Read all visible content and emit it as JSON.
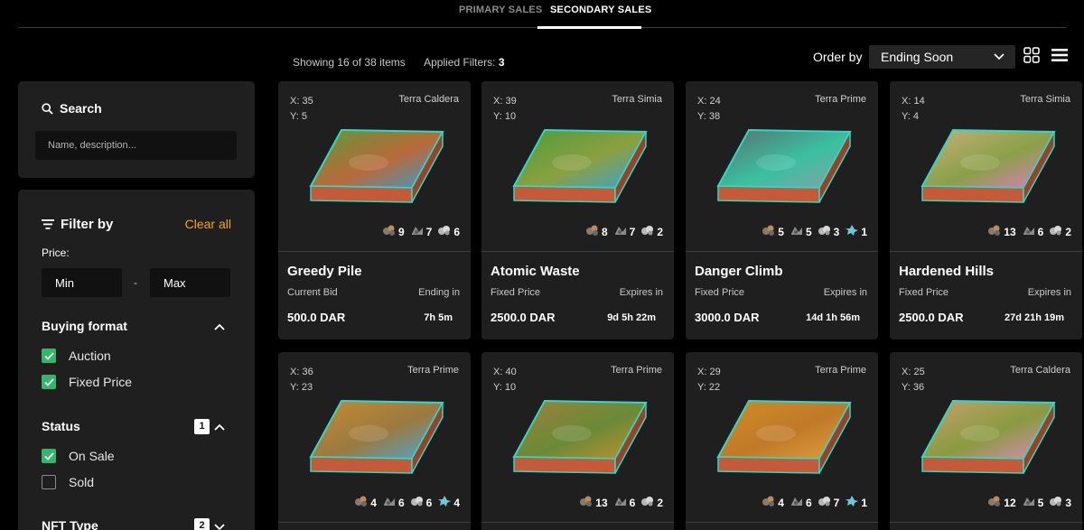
{
  "tabs": {
    "primary": "PRIMARY SALES",
    "secondary": "SECONDARY SALES"
  },
  "results": {
    "showing": "Showing 16 of 38 items",
    "filters_label": "Applied Filters:",
    "filters_count": "3"
  },
  "order": {
    "label": "Order by",
    "selected": "Ending Soon"
  },
  "search": {
    "title": "Search",
    "placeholder": "Name, description..."
  },
  "filter": {
    "title": "Filter by",
    "clear_all": "Clear all",
    "price_label": "Price:",
    "price_min": "Min",
    "price_sep": "-",
    "price_max": "Max",
    "buying_format": {
      "title": "Buying format",
      "options": [
        "Auction",
        "Fixed Price"
      ]
    },
    "status": {
      "title": "Status",
      "count": "1",
      "options": [
        "On Sale",
        "Sold"
      ]
    },
    "nft_type": {
      "title": "NFT Type",
      "count": "2"
    }
  },
  "colors": {
    "accent": "#f4a31c",
    "checkbox": "#33b66b",
    "tile_glow": "#2fd8c8",
    "tile_side": "#c45a38"
  },
  "cards": [
    {
      "x": "X: 35",
      "y": "Y: 5",
      "region": "Terra Caldera",
      "name": "Greedy Pile",
      "price_type": "Current Bid",
      "time_label": "Ending in",
      "price": "500.0 DAR",
      "time": "7h 5m",
      "r": [
        "9",
        "7",
        "6"
      ],
      "top": "#5e9a3a",
      "top2": "#b86a3a",
      "top3": "#3a9ad0"
    },
    {
      "x": "X: 39",
      "y": "Y: 10",
      "region": "Terra Simia",
      "name": "Atomic Waste",
      "price_type": "Fixed Price",
      "time_label": "Expires in",
      "price": "2500.0 DAR",
      "time": "9d 5h 22m",
      "r": [
        "8",
        "7",
        "2"
      ],
      "top": "#4f9a3a",
      "top2": "#8aa040",
      "top3": "#3aa0d8"
    },
    {
      "x": "X: 24",
      "y": "Y: 38",
      "region": "Terra Prime",
      "name": "Danger Climb",
      "price_type": "Fixed Price",
      "time_label": "Expires in",
      "price": "3000.0 DAR",
      "time": "14d 1h 56m",
      "r": [
        "5",
        "5",
        "3",
        "1"
      ],
      "top": "#5a6e6e",
      "top2": "#3ac0a0",
      "top3": "#8aa0a8"
    },
    {
      "x": "X: 14",
      "y": "Y: 4",
      "region": "Terra Simia",
      "name": "Hardened Hills",
      "price_type": "Fixed Price",
      "time_label": "Expires in",
      "price": "2500.0 DAR",
      "time": "27d 21h 19m",
      "r": [
        "13",
        "6",
        "2"
      ],
      "top": "#c8b07a",
      "top2": "#8aa048",
      "top3": "#e07ac8"
    },
    {
      "x": "X: 36",
      "y": "Y: 23",
      "region": "Terra Prime",
      "name": "",
      "price_type": "",
      "time_label": "",
      "price": "",
      "time": "",
      "r": [
        "4",
        "6",
        "6",
        "4"
      ],
      "top": "#c88a30",
      "top2": "#9a7a40",
      "top3": "#4aa8d8"
    },
    {
      "x": "X: 40",
      "y": "Y: 10",
      "region": "Terra Prime",
      "name": "",
      "price_type": "",
      "time_label": "",
      "price": "",
      "time": "",
      "r": [
        "13",
        "6",
        "2"
      ],
      "top": "#a08038",
      "top2": "#6a8a38",
      "top3": "#c8902e"
    },
    {
      "x": "X: 29",
      "y": "Y: 22",
      "region": "Terra Prime",
      "name": "",
      "price_type": "",
      "time_label": "",
      "price": "",
      "time": "",
      "r": [
        "4",
        "6",
        "7",
        "1"
      ],
      "top": "#d08a28",
      "top2": "#c07a28",
      "top3": "#e0a040"
    },
    {
      "x": "X: 25",
      "y": "Y: 36",
      "region": "Terra Caldera",
      "name": "",
      "price_type": "",
      "time_label": "",
      "price": "",
      "time": "",
      "r": [
        "12",
        "5",
        "3"
      ],
      "top": "#c8a070",
      "top2": "#8a9a40",
      "top3": "#e08ac0"
    }
  ]
}
